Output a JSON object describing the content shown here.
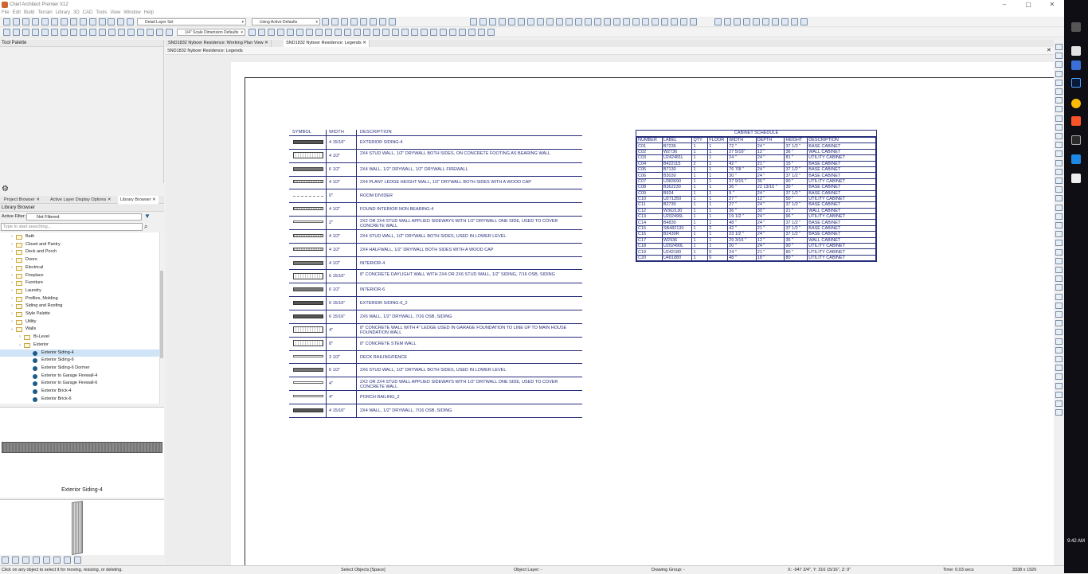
{
  "window": {
    "title": "Chief Architect Premier X12"
  },
  "menu": [
    "File",
    "Edit",
    "Build",
    "Terrain",
    "Library",
    "3D",
    "CAD",
    "Tools",
    "View",
    "Window",
    "Help"
  ],
  "toolbar": {
    "layer_set": "Detail Layer Set",
    "defaults": "Using Active Defaults",
    "dimension_defaults": "1/4\" Scale Dimension Defaults"
  },
  "tool_palette": {
    "title": "Tool Palette"
  },
  "panel_tabs": [
    "Project Browser",
    "Active Layer Display Options",
    "Library Browser"
  ],
  "library": {
    "title": "Library Browser",
    "filter_label": "Active Filter:",
    "filter_value": "Not Filtered",
    "search_placeholder": "Type to start searching...",
    "tree": [
      {
        "label": "Bath",
        "level": 1,
        "type": "folder"
      },
      {
        "label": "Closet and Pantry",
        "level": 1,
        "type": "folder"
      },
      {
        "label": "Deck and Porch",
        "level": 1,
        "type": "folder"
      },
      {
        "label": "Doors",
        "level": 1,
        "type": "folder"
      },
      {
        "label": "Electrical",
        "level": 1,
        "type": "folder"
      },
      {
        "label": "Fireplace",
        "level": 1,
        "type": "folder"
      },
      {
        "label": "Furniture",
        "level": 1,
        "type": "folder"
      },
      {
        "label": "Laundry",
        "level": 1,
        "type": "folder"
      },
      {
        "label": "Profiles, Molding",
        "level": 1,
        "type": "folder"
      },
      {
        "label": "Siding and Roofing",
        "level": 1,
        "type": "folder"
      },
      {
        "label": "Style Palette",
        "level": 1,
        "type": "folder"
      },
      {
        "label": "Utility",
        "level": 1,
        "type": "folder"
      },
      {
        "label": "Walls",
        "level": 1,
        "type": "folder",
        "open": true
      },
      {
        "label": "Bi-Level",
        "level": 2,
        "type": "folder"
      },
      {
        "label": "Exterior",
        "level": 2,
        "type": "folder",
        "open": true
      },
      {
        "label": "Exterior Siding-4",
        "level": 3,
        "type": "item",
        "selected": true
      },
      {
        "label": "Exterior Siding-6",
        "level": 3,
        "type": "item"
      },
      {
        "label": "Exterior Siding-6 Dormer",
        "level": 3,
        "type": "item"
      },
      {
        "label": "Exterior to Garage Firewall-4",
        "level": 3,
        "type": "item"
      },
      {
        "label": "Exterior to Garage Firewall-6",
        "level": 3,
        "type": "item"
      },
      {
        "label": "Exterior Brick-4",
        "level": 3,
        "type": "item"
      },
      {
        "label": "Exterior Brick-6",
        "level": 3,
        "type": "item"
      }
    ],
    "preview_label": "Exterior Siding-4"
  },
  "doc_tabs": [
    "SND1832 Nyboer Residence: Working Plan View",
    "SND1832 Nyboer Residence: Legends"
  ],
  "doc_header": "SND1832 Nyboer Residence: Legends",
  "legend": {
    "headers": [
      "SYMBOL",
      "WIDTH",
      "DESCRIPTION"
    ],
    "rows": [
      {
        "sym": "dark",
        "width": "4 15/16\"",
        "desc": "EXTERIOR SIDING-4"
      },
      {
        "sym": "hatch",
        "width": "4 1/2\"",
        "desc": "2X4 STUD WALL, 1/2\" DRYWALL BOTH SIDES, ON CONCRETE FOOTING AS BEARING WALL"
      },
      {
        "sym": "mid",
        "width": "6 1/2\"",
        "desc": "2X4 WALL, 1/2\" DRYWALL, 1/2\" DRYWALL FIREWALL"
      },
      {
        "sym": "light",
        "width": "4 1/2\"",
        "desc": "2X4 PLANT LEDGE HEIGHT WALL, 1/2\" DRYWALL BOTH SIDES WITH A WOOD CAP"
      },
      {
        "sym": "dash",
        "width": "0\"",
        "desc": "ROOM DIVIDER"
      },
      {
        "sym": "light",
        "width": "4 1/2\"",
        "desc": "FOUND INTERIOR NON BEARING-4"
      },
      {
        "sym": "thin",
        "width": "2\"",
        "desc": "2X2 OR 2X4 STUD WALL APPLIED SIDEWAYS WITH 1/2\" DRYWALL ONE SIDE, USED TO COVER CONCRETE WALL"
      },
      {
        "sym": "light",
        "width": "4 1/2\"",
        "desc": "2X4 STUD WALL, 1/2\" DRYWALL BOTH SIDES, USED IN LOWER LEVEL"
      },
      {
        "sym": "light",
        "width": "4 1/2\"",
        "desc": "2X4 HALFWALL, 1/2\" DRYWALL BOTH SIDES WITH A WOOD CAP"
      },
      {
        "sym": "mid",
        "width": "4 1/2\"",
        "desc": "INTERIOR-4"
      },
      {
        "sym": "hatch",
        "width": "6 15/16\"",
        "desc": "8\" CONCRETE DAYLIGHT WALL WITH 2X4 OR 2X6 STUD WALL, 1/2\" SIDING, 7/16 OSB, SIDING"
      },
      {
        "sym": "mid",
        "width": "6 1/2\"",
        "desc": "INTERIOR-6"
      },
      {
        "sym": "dark",
        "width": "6 15/16\"",
        "desc": "EXTERIOR SIDING-6_2"
      },
      {
        "sym": "dark",
        "width": "6 15/16\"",
        "desc": "2X6 WALL, 1/2\" DRYWALL, 7/16 OSB, SIDING"
      },
      {
        "sym": "hatch",
        "width": "4\"",
        "desc": "8\" CONCRETE WALL WITH 4\" LEDGE USED IN GARAGE FOUNDATION TO LINE UP TO MAIN HOUSE FOUNDATION WALL"
      },
      {
        "sym": "hatch",
        "width": "8\"",
        "desc": "8\" CONCRETE STEM WALL"
      },
      {
        "sym": "thin",
        "width": "3 1/2\"",
        "desc": "DECK RAILING/FENCE"
      },
      {
        "sym": "mid",
        "width": "6 1/2\"",
        "desc": "2X6 STUD WALL, 1/2\" DRYWALL BOTH SIDES, USED IN LOWER LEVEL"
      },
      {
        "sym": "thin",
        "width": "4\"",
        "desc": "2X2 OR 2X4 STUD WALL APPLIED SIDEWAYS WITH 1/2\" DRYWALL ONE SIDE, USED TO COVER CONCRETE WALL"
      },
      {
        "sym": "thin",
        "width": "4\"",
        "desc": "PORCH RAILING_2"
      },
      {
        "sym": "dark",
        "width": "4 15/16\"",
        "desc": "2X4 WALL, 1/2\" DRYWALL, 7/16 OSB, SIDING"
      }
    ]
  },
  "schedule": {
    "title": "CABINET SCHEDULE",
    "headers": [
      "NUMBER",
      "LABEL",
      "QTY",
      "FLOOR",
      "WIDTH",
      "DEPTH",
      "HEIGHT",
      "DESCRIPTION"
    ],
    "rows": [
      [
        "C01",
        "B7236",
        "1",
        "1",
        "72 \"",
        "24 \"",
        "37 1/2 \"",
        "BASE CABINET"
      ],
      [
        "C02",
        "W2736",
        "1",
        "1",
        "27 5/16\"",
        "12 \"",
        "36 \"",
        "WALL CABINET"
      ],
      [
        "C03",
        "U242481L",
        "1",
        "1",
        "24 \"",
        "24 \"",
        "81 \"",
        "UTILITY CABINET"
      ],
      [
        "C04",
        "B422115",
        "2",
        "1",
        "42 \"",
        "21 \"",
        "15 \"",
        "BASE CABINET"
      ],
      [
        "C05",
        "B7130",
        "1",
        "1",
        "76 7/8 \"",
        "24 \"",
        "37 1/2 \"",
        "BASE CABINET"
      ],
      [
        "C06",
        "B3030",
        "1",
        "1",
        "30 \"",
        "24 \"",
        "37 1/2 \"",
        "BASE CABINET"
      ],
      [
        "C07",
        "U383690",
        "1",
        "1",
        "37 9/16 \"",
        "36 \"",
        "90 \"",
        "UTILITY CABINET"
      ],
      [
        "C08",
        "B362230",
        "1",
        "1",
        "36 \"",
        "22 13/16 \"",
        "30 \"",
        "BASE CABINET"
      ],
      [
        "C09",
        "B924",
        "1",
        "1",
        "9 \"",
        "24 \"",
        "37 1/2 \"",
        "BASE CABINET"
      ],
      [
        "C10",
        "U271250",
        "1",
        "1",
        "27 \"",
        "12 \"",
        "50 \"",
        "UTILITY CABINET"
      ],
      [
        "C11",
        "B2730",
        "1",
        "1",
        "27 \"",
        "24 \"",
        "37 1/2 \"",
        "BASE CABINET"
      ],
      [
        "C12",
        "W362130",
        "1",
        "1",
        "36 \"",
        "30 \"",
        "21 \"",
        "WALL CABINET"
      ],
      [
        "C13",
        "U202496L",
        "1",
        "1",
        "19 1/2 \"",
        "24 \"",
        "96 \"",
        "UTILITY CABINET"
      ],
      [
        "C14",
        "B4830",
        "1",
        "1",
        "48 \"",
        "24 \"",
        "37 1/2 \"",
        "BASE CABINET"
      ],
      [
        "C15",
        "SB482130",
        "1",
        "2",
        "42 \"",
        "21 \"",
        "37 1/2 \"",
        "BASE CABINET"
      ],
      [
        "C16",
        "B2430R",
        "1",
        "1",
        "23 1/2 \"",
        "24 \"",
        "37 1/2 \"",
        "BASE CABINET"
      ],
      [
        "C17",
        "W2936",
        "1",
        "1",
        "29 3/16 \"",
        "12 \"",
        "36 \"",
        "WALL CABINET"
      ],
      [
        "C18",
        "U202490L",
        "1",
        "1",
        "20 \"",
        "24 \"",
        "90 \"",
        "UTILITY CABINET"
      ],
      [
        "C19",
        "U242180",
        "1",
        "0",
        "24 \"",
        "21 \"",
        "80 \"",
        "UTILITY CABINET"
      ],
      [
        "C20",
        "U481880",
        "1",
        "0",
        "48 \"",
        "18 \"",
        "80 \"",
        "UTILITY CABINET"
      ]
    ]
  },
  "status": {
    "hint": "Click on any object to select it for moving, resizing, or deleting.",
    "mode": "Select Objects [Space]",
    "object_layer": "Object Layer: -",
    "drawing_group": "Drawing Group: -",
    "coords": "X: -947 3/4\", Y: 316 15/16\", Z: 0\"",
    "time": "Time: 0.03 secs",
    "resolution": "3338 x 1920"
  },
  "clock": "9:42 AM"
}
